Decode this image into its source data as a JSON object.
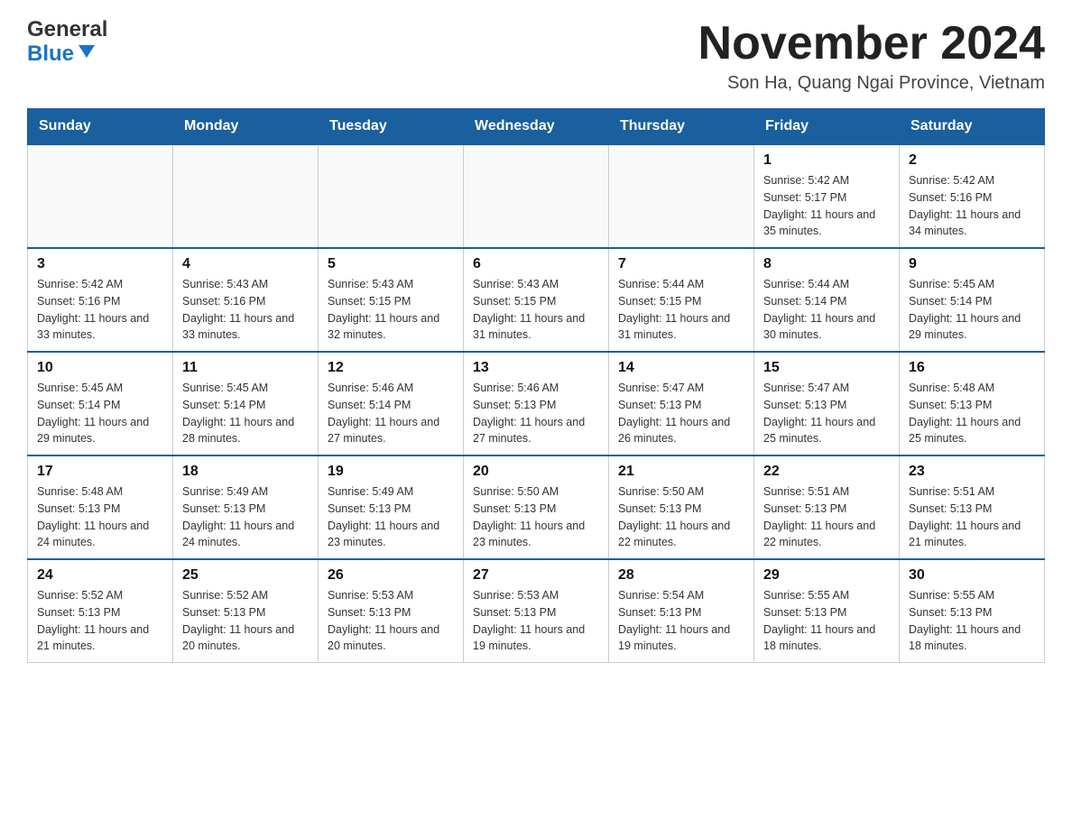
{
  "header": {
    "logo_general": "General",
    "logo_blue": "Blue",
    "title": "November 2024",
    "subtitle": "Son Ha, Quang Ngai Province, Vietnam"
  },
  "calendar": {
    "days_of_week": [
      "Sunday",
      "Monday",
      "Tuesday",
      "Wednesday",
      "Thursday",
      "Friday",
      "Saturday"
    ],
    "weeks": [
      [
        {
          "day": "",
          "info": ""
        },
        {
          "day": "",
          "info": ""
        },
        {
          "day": "",
          "info": ""
        },
        {
          "day": "",
          "info": ""
        },
        {
          "day": "",
          "info": ""
        },
        {
          "day": "1",
          "info": "Sunrise: 5:42 AM\nSunset: 5:17 PM\nDaylight: 11 hours and 35 minutes."
        },
        {
          "day": "2",
          "info": "Sunrise: 5:42 AM\nSunset: 5:16 PM\nDaylight: 11 hours and 34 minutes."
        }
      ],
      [
        {
          "day": "3",
          "info": "Sunrise: 5:42 AM\nSunset: 5:16 PM\nDaylight: 11 hours and 33 minutes."
        },
        {
          "day": "4",
          "info": "Sunrise: 5:43 AM\nSunset: 5:16 PM\nDaylight: 11 hours and 33 minutes."
        },
        {
          "day": "5",
          "info": "Sunrise: 5:43 AM\nSunset: 5:15 PM\nDaylight: 11 hours and 32 minutes."
        },
        {
          "day": "6",
          "info": "Sunrise: 5:43 AM\nSunset: 5:15 PM\nDaylight: 11 hours and 31 minutes."
        },
        {
          "day": "7",
          "info": "Sunrise: 5:44 AM\nSunset: 5:15 PM\nDaylight: 11 hours and 31 minutes."
        },
        {
          "day": "8",
          "info": "Sunrise: 5:44 AM\nSunset: 5:14 PM\nDaylight: 11 hours and 30 minutes."
        },
        {
          "day": "9",
          "info": "Sunrise: 5:45 AM\nSunset: 5:14 PM\nDaylight: 11 hours and 29 minutes."
        }
      ],
      [
        {
          "day": "10",
          "info": "Sunrise: 5:45 AM\nSunset: 5:14 PM\nDaylight: 11 hours and 29 minutes."
        },
        {
          "day": "11",
          "info": "Sunrise: 5:45 AM\nSunset: 5:14 PM\nDaylight: 11 hours and 28 minutes."
        },
        {
          "day": "12",
          "info": "Sunrise: 5:46 AM\nSunset: 5:14 PM\nDaylight: 11 hours and 27 minutes."
        },
        {
          "day": "13",
          "info": "Sunrise: 5:46 AM\nSunset: 5:13 PM\nDaylight: 11 hours and 27 minutes."
        },
        {
          "day": "14",
          "info": "Sunrise: 5:47 AM\nSunset: 5:13 PM\nDaylight: 11 hours and 26 minutes."
        },
        {
          "day": "15",
          "info": "Sunrise: 5:47 AM\nSunset: 5:13 PM\nDaylight: 11 hours and 25 minutes."
        },
        {
          "day": "16",
          "info": "Sunrise: 5:48 AM\nSunset: 5:13 PM\nDaylight: 11 hours and 25 minutes."
        }
      ],
      [
        {
          "day": "17",
          "info": "Sunrise: 5:48 AM\nSunset: 5:13 PM\nDaylight: 11 hours and 24 minutes."
        },
        {
          "day": "18",
          "info": "Sunrise: 5:49 AM\nSunset: 5:13 PM\nDaylight: 11 hours and 24 minutes."
        },
        {
          "day": "19",
          "info": "Sunrise: 5:49 AM\nSunset: 5:13 PM\nDaylight: 11 hours and 23 minutes."
        },
        {
          "day": "20",
          "info": "Sunrise: 5:50 AM\nSunset: 5:13 PM\nDaylight: 11 hours and 23 minutes."
        },
        {
          "day": "21",
          "info": "Sunrise: 5:50 AM\nSunset: 5:13 PM\nDaylight: 11 hours and 22 minutes."
        },
        {
          "day": "22",
          "info": "Sunrise: 5:51 AM\nSunset: 5:13 PM\nDaylight: 11 hours and 22 minutes."
        },
        {
          "day": "23",
          "info": "Sunrise: 5:51 AM\nSunset: 5:13 PM\nDaylight: 11 hours and 21 minutes."
        }
      ],
      [
        {
          "day": "24",
          "info": "Sunrise: 5:52 AM\nSunset: 5:13 PM\nDaylight: 11 hours and 21 minutes."
        },
        {
          "day": "25",
          "info": "Sunrise: 5:52 AM\nSunset: 5:13 PM\nDaylight: 11 hours and 20 minutes."
        },
        {
          "day": "26",
          "info": "Sunrise: 5:53 AM\nSunset: 5:13 PM\nDaylight: 11 hours and 20 minutes."
        },
        {
          "day": "27",
          "info": "Sunrise: 5:53 AM\nSunset: 5:13 PM\nDaylight: 11 hours and 19 minutes."
        },
        {
          "day": "28",
          "info": "Sunrise: 5:54 AM\nSunset: 5:13 PM\nDaylight: 11 hours and 19 minutes."
        },
        {
          "day": "29",
          "info": "Sunrise: 5:55 AM\nSunset: 5:13 PM\nDaylight: 11 hours and 18 minutes."
        },
        {
          "day": "30",
          "info": "Sunrise: 5:55 AM\nSunset: 5:13 PM\nDaylight: 11 hours and 18 minutes."
        }
      ]
    ]
  }
}
